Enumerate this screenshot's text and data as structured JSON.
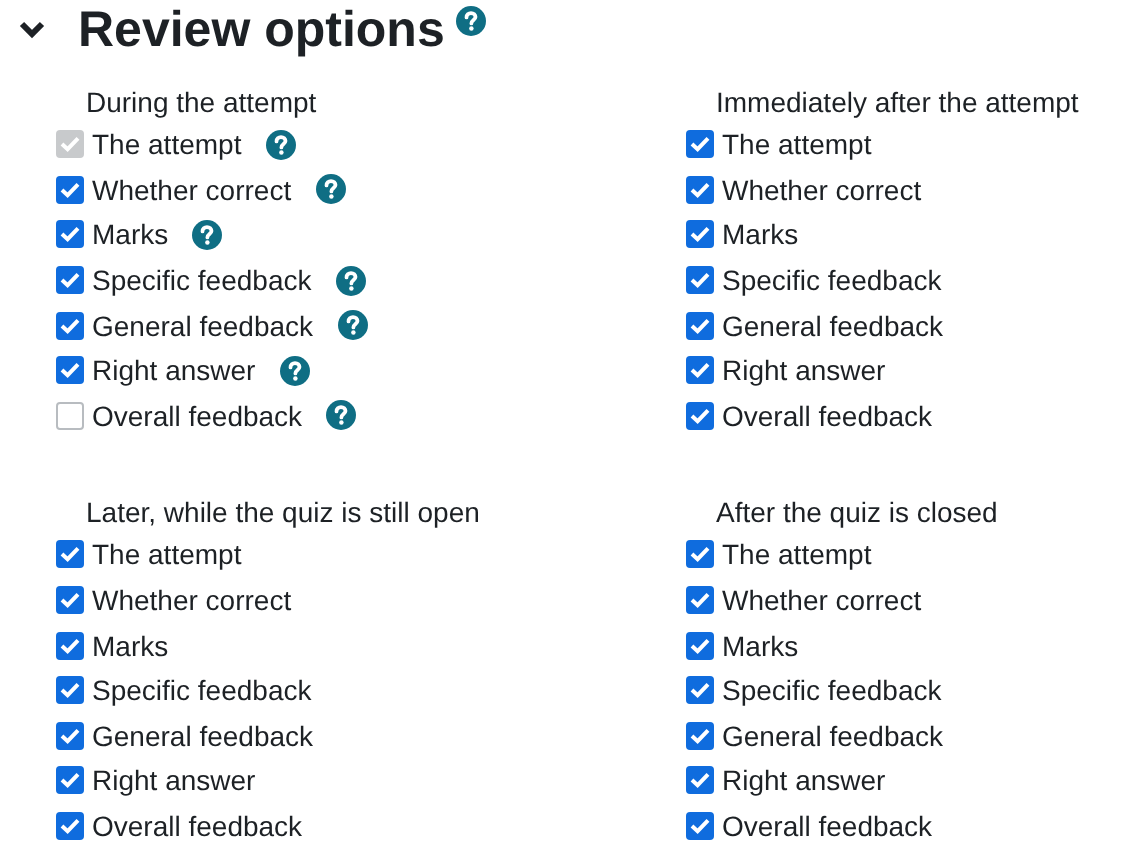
{
  "section": {
    "title": "Review options",
    "expanded": true,
    "help": true
  },
  "groups": [
    {
      "title": "During the attempt",
      "items": [
        {
          "label": "The attempt",
          "checked": true,
          "disabled": true,
          "help": true
        },
        {
          "label": "Whether correct",
          "checked": true,
          "disabled": false,
          "help": true
        },
        {
          "label": "Marks",
          "checked": true,
          "disabled": false,
          "help": true
        },
        {
          "label": "Specific feedback",
          "checked": true,
          "disabled": false,
          "help": true
        },
        {
          "label": "General feedback",
          "checked": true,
          "disabled": false,
          "help": true
        },
        {
          "label": "Right answer",
          "checked": true,
          "disabled": false,
          "help": true
        },
        {
          "label": "Overall feedback",
          "checked": false,
          "disabled": false,
          "help": true
        }
      ]
    },
    {
      "title": "Immediately after the attempt",
      "items": [
        {
          "label": "The attempt",
          "checked": true,
          "disabled": false,
          "help": false
        },
        {
          "label": "Whether correct",
          "checked": true,
          "disabled": false,
          "help": false
        },
        {
          "label": "Marks",
          "checked": true,
          "disabled": false,
          "help": false
        },
        {
          "label": "Specific feedback",
          "checked": true,
          "disabled": false,
          "help": false
        },
        {
          "label": "General feedback",
          "checked": true,
          "disabled": false,
          "help": false
        },
        {
          "label": "Right answer",
          "checked": true,
          "disabled": false,
          "help": false
        },
        {
          "label": "Overall feedback",
          "checked": true,
          "disabled": false,
          "help": false
        }
      ]
    },
    {
      "title": "Later, while the quiz is still open",
      "items": [
        {
          "label": "The attempt",
          "checked": true,
          "disabled": false,
          "help": false
        },
        {
          "label": "Whether correct",
          "checked": true,
          "disabled": false,
          "help": false
        },
        {
          "label": "Marks",
          "checked": true,
          "disabled": false,
          "help": false
        },
        {
          "label": "Specific feedback",
          "checked": true,
          "disabled": false,
          "help": false
        },
        {
          "label": "General feedback",
          "checked": true,
          "disabled": false,
          "help": false
        },
        {
          "label": "Right answer",
          "checked": true,
          "disabled": false,
          "help": false
        },
        {
          "label": "Overall feedback",
          "checked": true,
          "disabled": false,
          "help": false
        }
      ]
    },
    {
      "title": "After the quiz is closed",
      "items": [
        {
          "label": "The attempt",
          "checked": true,
          "disabled": false,
          "help": false
        },
        {
          "label": "Whether correct",
          "checked": true,
          "disabled": false,
          "help": false
        },
        {
          "label": "Marks",
          "checked": true,
          "disabled": false,
          "help": false
        },
        {
          "label": "Specific feedback",
          "checked": true,
          "disabled": false,
          "help": false
        },
        {
          "label": "General feedback",
          "checked": true,
          "disabled": false,
          "help": false
        },
        {
          "label": "Right answer",
          "checked": true,
          "disabled": false,
          "help": false
        },
        {
          "label": "Overall feedback",
          "checked": true,
          "disabled": false,
          "help": false
        }
      ]
    }
  ]
}
